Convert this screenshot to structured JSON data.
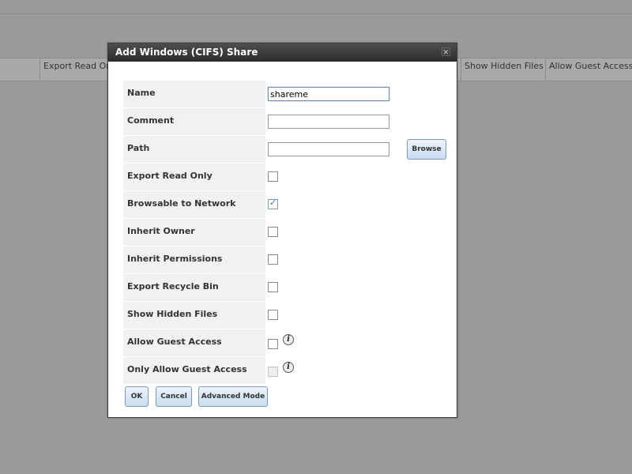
{
  "background": {
    "columns": [
      "Export Read Only",
      "Show Hidden Files",
      "Allow Guest Access"
    ]
  },
  "dialog": {
    "title": "Add Windows (CIFS) Share",
    "close_glyph": "×",
    "fields": {
      "name_label": "Name",
      "name_value": "shareme",
      "comment_label": "Comment",
      "comment_value": "",
      "path_label": "Path",
      "path_value": "",
      "browse_label": "Browse",
      "export_read_only": "Export Read Only",
      "browsable": "Browsable to Network Clients",
      "inherit_owner": "Inherit Owner",
      "inherit_permissions": "Inherit Permissions",
      "export_recycle_bin": "Export Recycle Bin",
      "show_hidden_files": "Show Hidden Files",
      "allow_guest_access": "Allow Guest Access",
      "only_allow_guest_access": "Only Allow Guest Access"
    },
    "checkbox_states": {
      "export_read_only": false,
      "browsable": true,
      "inherit_owner": false,
      "inherit_permissions": false,
      "export_recycle_bin": false,
      "show_hidden_files": false,
      "allow_guest_access": false,
      "only_allow_guest_access": false
    },
    "info_glyph": "i",
    "buttons": {
      "ok": "OK",
      "cancel": "Cancel",
      "advanced": "Advanced Mode"
    }
  }
}
